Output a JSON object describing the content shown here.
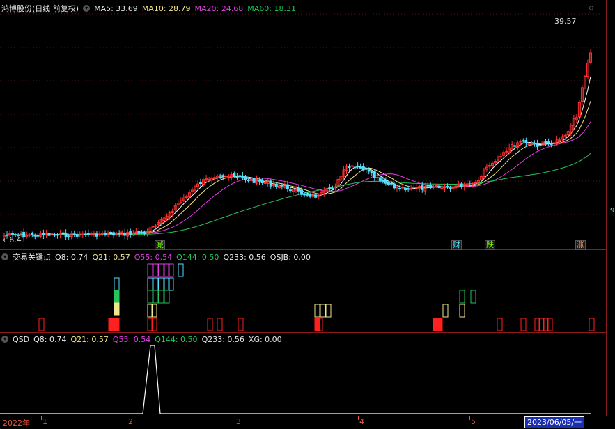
{
  "main": {
    "title": "鸿博股份(日线 前复权)",
    "ma5_label": "MA5: 33.69",
    "ma10_label": "MA10: 28.79",
    "ma20_label": "MA20: 24.68",
    "ma60_label": "MA60: 18.31",
    "high_label": "39.57",
    "low_label": "6.41",
    "badges": [
      "减",
      "财",
      "跌",
      "涨"
    ],
    "right_marker": "9"
  },
  "panel2": {
    "title": "交易关键点",
    "q8": "Q8: 0.74",
    "q21": "Q21: 0.57",
    "q55": "Q55: 0.54",
    "q144": "Q144: 0.50",
    "q233": "Q233: 0.56",
    "qsjb": "QSJB: 0.00"
  },
  "panel3": {
    "title": "QSD",
    "q8": "Q8: 0.74",
    "q21": "Q21: 0.57",
    "q55": "Q55: 0.54",
    "q144": "Q144: 0.50",
    "q233": "Q233: 0.56",
    "xg": "XG: 0.00"
  },
  "xaxis": {
    "labels": [
      "2022年",
      "1",
      "2",
      "3",
      "4",
      "5"
    ],
    "cursor_date": "2023/06/05/一"
  },
  "colors": {
    "up": "#ff3030",
    "down": "#54e0ff",
    "ma5": "#ffffff",
    "ma10": "#f0e68c",
    "ma20": "#e040e0",
    "ma60": "#22c55e",
    "grid": "#8b1a1a"
  }
}
